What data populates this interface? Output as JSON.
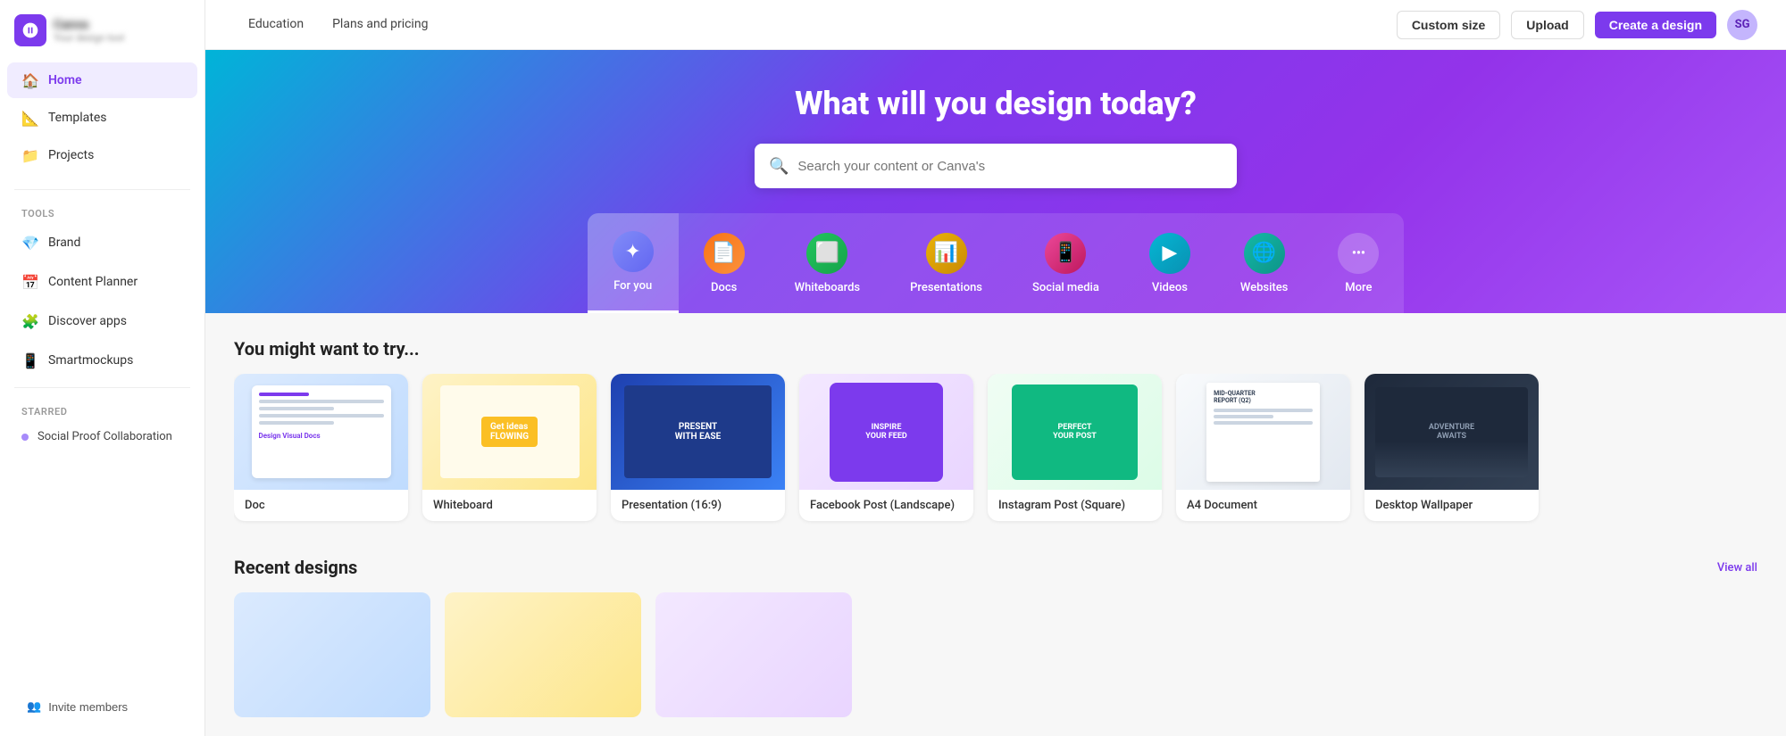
{
  "sidebar": {
    "logo_brand": "Canva",
    "logo_sub": "Your design tool",
    "nav_items": [
      {
        "id": "home",
        "label": "Home",
        "icon": "🏠",
        "active": true
      },
      {
        "id": "templates",
        "label": "Templates",
        "icon": "📐",
        "active": false
      },
      {
        "id": "projects",
        "label": "Projects",
        "icon": "📁",
        "active": false
      }
    ],
    "tools_label": "Tools",
    "tools": [
      {
        "id": "brand",
        "label": "Brand",
        "icon": "💎"
      },
      {
        "id": "content-planner",
        "label": "Content Planner",
        "icon": "📅"
      },
      {
        "id": "discover-apps",
        "label": "Discover apps",
        "icon": "🧩"
      },
      {
        "id": "smartmockups",
        "label": "Smartmockups",
        "icon": "📱"
      }
    ],
    "starred_label": "Starred",
    "starred_items": [
      {
        "id": "social-proof",
        "label": "Social Proof Collaboration"
      }
    ],
    "invite_label": "Invite members"
  },
  "topnav": {
    "items": [
      {
        "id": "education",
        "label": "Education"
      },
      {
        "id": "plans",
        "label": "Plans and pricing"
      }
    ],
    "create_btn": "Create a design",
    "upload_btn": "Upload",
    "custom_size_btn": "Custom size",
    "avatar_initials": "SG"
  },
  "hero": {
    "title": "What will you design today?",
    "search_placeholder": "Search your content or Canva's"
  },
  "quick_access": {
    "items": [
      {
        "id": "for-you",
        "label": "For you",
        "icon": "✦",
        "icon_class": "qi-foryou",
        "active": true
      },
      {
        "id": "docs",
        "label": "Docs",
        "icon": "📄",
        "icon_class": "qi-docs"
      },
      {
        "id": "whiteboards",
        "label": "Whiteboards",
        "icon": "⬜",
        "icon_class": "qi-whiteboards"
      },
      {
        "id": "presentations",
        "label": "Presentations",
        "icon": "📊",
        "icon_class": "qi-presentations"
      },
      {
        "id": "social-media",
        "label": "Social media",
        "icon": "📱",
        "icon_class": "qi-socialmedia"
      },
      {
        "id": "videos",
        "label": "Videos",
        "icon": "▶",
        "icon_class": "qi-videos"
      },
      {
        "id": "websites",
        "label": "Websites",
        "icon": "🌐",
        "icon_class": "qi-websites"
      },
      {
        "id": "more",
        "label": "More",
        "icon": "···",
        "icon_class": "qi-more"
      }
    ]
  },
  "try_section": {
    "title": "You might want to try...",
    "cards": [
      {
        "id": "doc",
        "label": "Doc",
        "thumb_class": "dc-doc"
      },
      {
        "id": "whiteboard",
        "label": "Whiteboard",
        "thumb_class": "dc-whiteboard"
      },
      {
        "id": "presentation",
        "label": "Presentation (16:9)",
        "thumb_class": "dc-presentation"
      },
      {
        "id": "facebook-post",
        "label": "Facebook Post (Landscape)",
        "thumb_class": "dc-facebook"
      },
      {
        "id": "instagram-post",
        "label": "Instagram Post (Square)",
        "thumb_class": "dc-instagram"
      },
      {
        "id": "a4-document",
        "label": "A4 Document",
        "thumb_class": "dc-a4"
      },
      {
        "id": "desktop-wallpaper",
        "label": "Desktop Wallpaper",
        "thumb_class": "dc-desktop"
      }
    ]
  },
  "recent_section": {
    "title": "Recent designs",
    "view_all_label": "View all"
  }
}
